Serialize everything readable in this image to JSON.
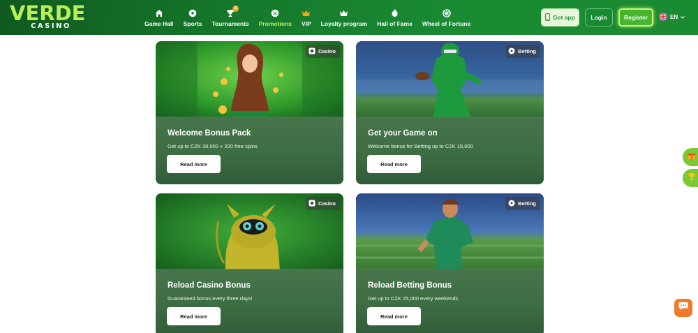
{
  "brand": {
    "logo_main": "VERDE",
    "logo_sub": "CASINO",
    "accent": "#b8f05a",
    "header_green": "#15792b"
  },
  "nav": {
    "items": [
      {
        "label": "Game Hall",
        "icon": "home-icon"
      },
      {
        "label": "Sports",
        "icon": "soccer-ball-icon"
      },
      {
        "label": "Tournaments",
        "icon": "trophy-icon",
        "badge": "3"
      },
      {
        "label": "Promotions",
        "icon": "percent-icon",
        "active": true
      },
      {
        "label": "VIP",
        "icon": "crown-icon"
      },
      {
        "label": "Loyalty program",
        "icon": "crown-outline-icon"
      },
      {
        "label": "Hall of Fame",
        "icon": "flame-icon"
      },
      {
        "label": "Wheel of Fortune",
        "icon": "wheel-icon"
      }
    ]
  },
  "header": {
    "get_app": "Get app",
    "login": "Login",
    "register": "Register",
    "language": "EN"
  },
  "promotions": [
    {
      "category": "Casino",
      "title": "Welcome Bonus Pack",
      "subtitle": "Get up to CZK 30,000 + 220 free spins",
      "cta": "Read more"
    },
    {
      "category": "Betting",
      "title": "Get your Game on",
      "subtitle": "Welcome bonus for Betting up to CZK 15,000",
      "cta": "Read more"
    },
    {
      "category": "Casino",
      "title": "Reload Casino Bonus",
      "subtitle": "Guaranteed bonus every three days!",
      "cta": "Read more"
    },
    {
      "category": "Betting",
      "title": "Reload Betting Bonus",
      "subtitle": "Get up to CZK 25,000 every weekends",
      "cta": "Read more"
    }
  ]
}
